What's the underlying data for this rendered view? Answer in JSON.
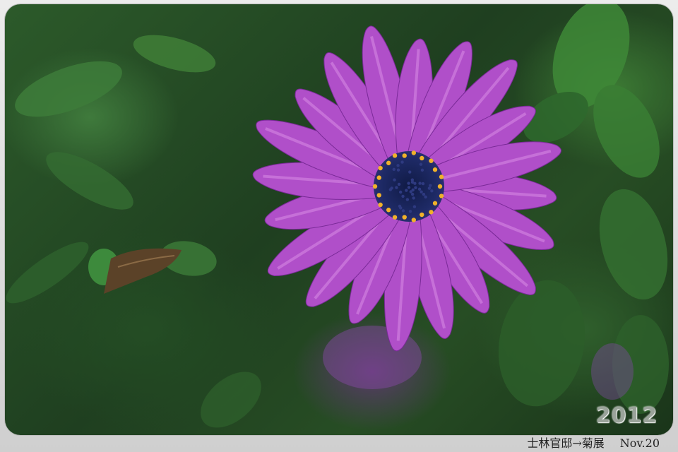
{
  "photo": {
    "subject": "purple daisy flower",
    "colors": {
      "petal": "#b04fc9",
      "petal_light": "#d98be6",
      "center": "#1e2a5a",
      "pollen": "#f0b22a",
      "foliage": "#2f6b2c"
    }
  },
  "watermark": {
    "year": "2012"
  },
  "caption": {
    "title": "士林官邸→菊展",
    "date": "Nov.20"
  }
}
